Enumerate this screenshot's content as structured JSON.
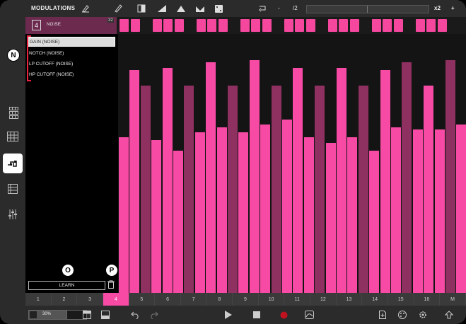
{
  "header": {
    "title": "MODULATIONS",
    "page_fraction": "/2",
    "minus": "-",
    "plus": "+",
    "multiplier": "x2"
  },
  "track": {
    "number": "4",
    "name": "NOISE",
    "count": "32"
  },
  "params": [
    "GAIN (NOISE)",
    "NOTCH (NOISE)",
    "LP CUTOFF (NOISE)",
    "HP CUTOFF (NOISE)"
  ],
  "learn_label": "LEARN",
  "badges": {
    "n": "N",
    "o": "O",
    "p": "P"
  },
  "step_selector": [
    "1",
    "2",
    "3",
    "4",
    "5",
    "6",
    "7",
    "8",
    "9",
    "10",
    "11",
    "12",
    "13",
    "14",
    "15",
    "16",
    "M"
  ],
  "active_step": "4",
  "zoom_label": "30%",
  "colors": {
    "accent": "#f74aa5",
    "accent_dim": "#8e3060",
    "track_head": "#6b2a4e",
    "bracket": "#e8233f"
  },
  "step_pattern": [
    1,
    1,
    0,
    1,
    1,
    1,
    0,
    1,
    1,
    1,
    0,
    1,
    1,
    1,
    0,
    1,
    1,
    1,
    0,
    1,
    1,
    1,
    0,
    1,
    1,
    1,
    0,
    1,
    1,
    1,
    0,
    1
  ],
  "modulation_values": [
    0.6,
    0.86,
    0.8,
    0.59,
    0.87,
    0.55,
    0.8,
    0.62,
    0.89,
    0.64,
    0.8,
    0.62,
    0.9,
    0.65,
    0.8,
    0.67,
    0.87,
    0.6,
    0.8,
    0.58,
    0.87,
    0.6,
    0.8,
    0.55,
    0.86,
    0.64,
    0.89,
    0.63,
    0.8,
    0.63,
    0.9,
    0.65,
    0.8,
    0.68
  ],
  "modulation_dim_pattern": [
    0,
    0,
    1,
    0,
    0,
    0,
    1,
    0,
    0,
    0,
    1,
    0,
    0,
    0,
    1,
    0,
    0,
    0,
    1,
    0,
    0,
    0,
    1,
    0,
    0,
    0,
    1,
    0,
    0,
    0,
    1,
    0,
    0,
    1
  ]
}
